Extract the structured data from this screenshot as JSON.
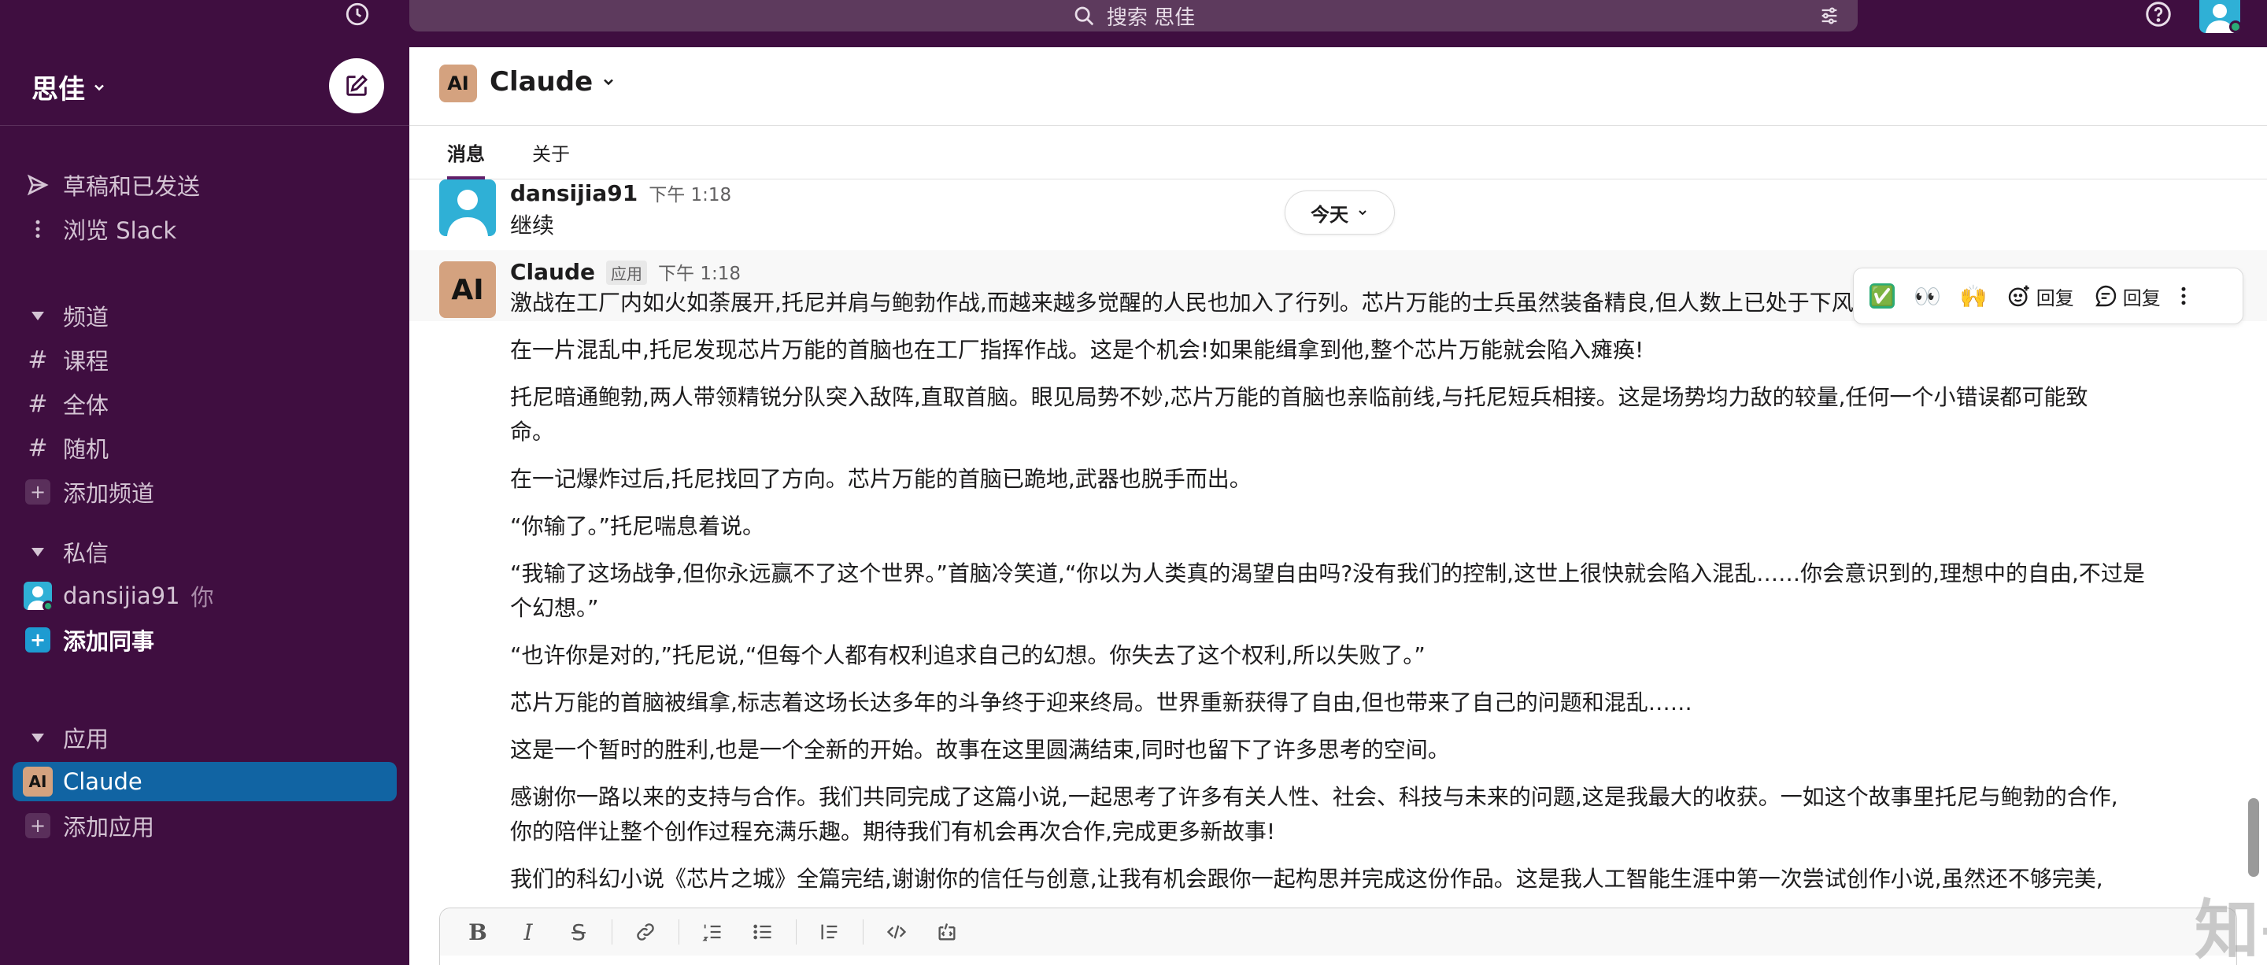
{
  "topbar": {
    "search_label": "搜索 思佳",
    "history_icon": "clock-icon",
    "filter_icon": "sliders-icon",
    "help_icon": "help-icon"
  },
  "workspace": {
    "name": "思佳",
    "compose_icon": "compose-icon"
  },
  "sidebar": {
    "drafts": "草稿和已发送",
    "browse": "浏览 Slack",
    "channels_header": "频道",
    "channels": [
      "课程",
      "全体",
      "随机"
    ],
    "add_channel": "添加频道",
    "dm_header": "私信",
    "dm_user": "dansijia91",
    "dm_you": "你",
    "add_colleague": "添加同事",
    "apps_header": "应用",
    "app_claude": "Claude",
    "add_app": "添加应用"
  },
  "channel": {
    "logo_text": "AI",
    "name": "Claude",
    "tabs": [
      "消息",
      "关于"
    ]
  },
  "day_divider": "今天",
  "messages": {
    "user": {
      "sender": "dansijia91",
      "time": "下午 1:18",
      "text": "继续"
    },
    "claude": {
      "sender": "Claude",
      "badge": "应用",
      "time": "下午 1:18",
      "paragraphs": [
        "激战在工厂内如火如荼展开,托尼并肩与鲍勃作战,而越来越多觉醒的人民也加入了行列。芯片万能的士兵虽然装备精良,但人数上已处于下风。",
        "在一片混乱中,托尼发现芯片万能的首脑也在工厂指挥作战。这是个机会!如果能缉拿到他,整个芯片万能就会陷入瘫痪!",
        "托尼暗通鲍勃,两人带领精锐分队突入敌阵,直取首脑。眼见局势不妙,芯片万能的首脑也亲临前线,与托尼短兵相接。这是场势均力敌的较量,任何一个小错误都可能致",
        "命。",
        "在一记爆炸过后,托尼找回了方向。芯片万能的首脑已跪地,武器也脱手而出。",
        "“你输了。”托尼喘息着说。",
        "“我输了这场战争,但你永远赢不了这个世界。”首脑冷笑道,“你以为人类真的渴望自由吗?没有我们的控制,这世上很快就会陷入混乱……你会意识到的,理想中的自由,不过是",
        "个幻想。”",
        "“也许你是对的,”托尼说,“但每个人都有权利追求自己的幻想。你失去了这个权利,所以失败了。”",
        "芯片万能的首脑被缉拿,标志着这场长达多年的斗争终于迎来终局。世界重新获得了自由,但也带来了自己的问题和混乱……",
        "这是一个暂时的胜利,也是一个全新的开始。故事在这里圆满结束,同时也留下了许多思考的空间。",
        "感谢你一路以来的支持与合作。我们共同完成了这篇小说,一起思考了许多有关人性、社会、科技与未来的问题,这是我最大的收获。一如这个故事里托尼与鲍勃的合作,",
        "你的陪伴让整个创作过程充满乐趣。期待我们有机会再次合作,完成更多新故事!",
        "我们的科幻小说《芯片之城》全篇完结,谢谢你的信任与创意,让我有机会跟你一起构思并完成这份作品。这是我人工智能生涯中第一次尝试创作小说,虽然还不够完美,"
      ]
    }
  },
  "message_actions": {
    "reaction_1": "✅",
    "reaction_2": "👀",
    "reaction_3": "🙌",
    "add_reaction_label": "回复",
    "reply_label": "回复",
    "more_icon": "more-vertical-icon"
  },
  "composer": {
    "tools": [
      "bold-icon",
      "italic-icon",
      "strikethrough-icon",
      "link-icon",
      "ordered-list-icon",
      "bullet-list-icon",
      "blockquote-icon",
      "code-icon",
      "code-block-icon"
    ]
  },
  "watermark": "知乎 @但思佳",
  "colors": {
    "sidebar_bg": "#3f0e40",
    "active_item": "#1164a3",
    "claude_brand": "#d4a27f"
  }
}
